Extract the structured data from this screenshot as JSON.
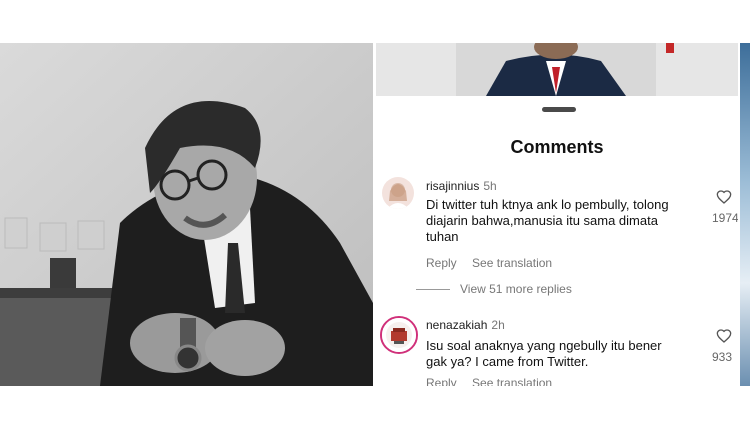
{
  "sheet": {
    "title": "Comments"
  },
  "comments": [
    {
      "username": "risajinnius",
      "time": "5h",
      "text_lines": [
        "Di twitter tuh ktnya ank lo pembully, tolong",
        "diajarin bahwa,manusia itu sama dimata",
        "tuhan"
      ],
      "reply_label": "Reply",
      "translation_label": "See translation",
      "likes": "1974",
      "view_replies": "View 51 more replies"
    },
    {
      "username": "nenazakiah",
      "time": "2h",
      "text_lines": [
        "Isu soal anaknya yang ngebully itu bener",
        "gak ya? I came from Twitter."
      ],
      "reply_label": "Reply",
      "translation_label": "See translation",
      "likes": "933"
    }
  ],
  "icons": {
    "like": "heart-icon"
  },
  "colors": {
    "background": "#ffffff",
    "meta_text": "#777777",
    "text": "#111111"
  }
}
